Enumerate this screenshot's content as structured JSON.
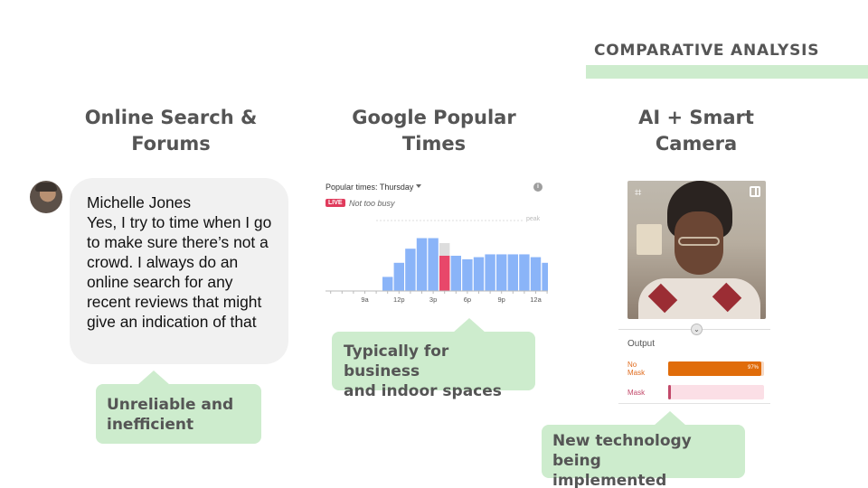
{
  "header": {
    "label": "COMPARATIVE ANALYSIS"
  },
  "columns": [
    {
      "title_line1": "Online Search &",
      "title_line2": "Forums"
    },
    {
      "title_line1": "Google Popular",
      "title_line2": "Times"
    },
    {
      "title_line1": "AI + Smart",
      "title_line2": "Camera"
    }
  ],
  "quote": {
    "name": "Michelle Jones",
    "text": "Yes, I try to time when I go to make sure there’s not a crowd. I always do an online search for any recent reviews that might give an indication of that"
  },
  "popular_times": {
    "title": "Popular times: Thursday",
    "info_icon": "i",
    "live_badge": "LIVE",
    "status": "Not too busy",
    "peak_label": "peak",
    "chart_data": {
      "type": "bar",
      "tick_labels": [
        "9a",
        "12p",
        "3p",
        "6p",
        "9p",
        "12a"
      ],
      "values": [
        0,
        0,
        0,
        0,
        0,
        20,
        40,
        60,
        75,
        75,
        50,
        50,
        45,
        48,
        52,
        52,
        52,
        52,
        48,
        40,
        35,
        28
      ],
      "live_index": 10,
      "live_usual": 68,
      "colors": {
        "bar": "#8ab4f8",
        "live": "#e8476a",
        "usual": "#dddddd",
        "axis": "#bbbbbb"
      }
    }
  },
  "camera": {
    "crop_icon": "crop-icon",
    "flip_icon": "flip-icon",
    "collapse_icon": "⌄",
    "output_label": "Output",
    "results": [
      {
        "label_line1": "No",
        "label_line2": "Mask",
        "percent_text": "97%",
        "fraction": 0.97
      },
      {
        "label_line1": "Mask",
        "label_line2": "",
        "percent_text": "",
        "fraction": 0.03
      }
    ]
  },
  "callouts": [
    {
      "line1": "Unreliable and",
      "line2": "inefficient"
    },
    {
      "line1": "Typically for business",
      "line2": "and indoor spaces"
    },
    {
      "line1": "New technology being",
      "line2": "implemented"
    }
  ]
}
